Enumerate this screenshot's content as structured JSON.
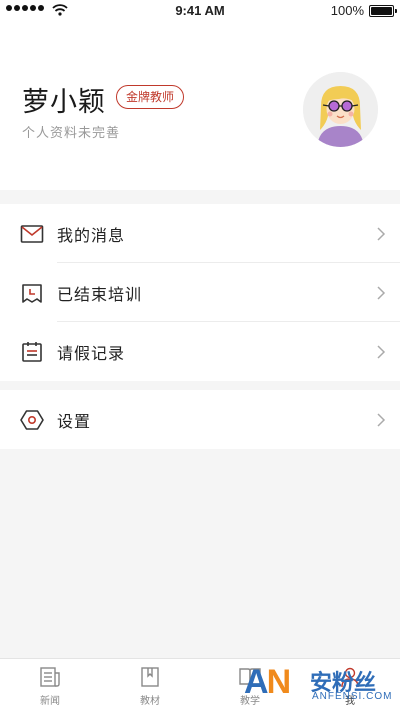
{
  "status_bar": {
    "time": "9:41 AM",
    "battery": "100%"
  },
  "profile": {
    "name": "萝小颖",
    "badge": "金牌教师",
    "subtitle": "个人资料未完善",
    "avatar_icon": "user-avatar-glasses"
  },
  "menu": {
    "messages": {
      "label": "我的消息",
      "icon": "mail-icon"
    },
    "finished_training": {
      "label": "已结束培训",
      "icon": "calendar-clock-icon"
    },
    "leave_records": {
      "label": "请假记录",
      "icon": "calendar-list-icon"
    },
    "settings": {
      "label": "设置",
      "icon": "hexagon-settings-icon"
    }
  },
  "tabs": [
    {
      "label": "新闻",
      "icon": "news-icon",
      "active": false
    },
    {
      "label": "教材",
      "icon": "book-icon",
      "active": false
    },
    {
      "label": "教学",
      "icon": "open-book-icon",
      "active": false
    },
    {
      "label": "我",
      "icon": "user-icon",
      "active": true
    }
  ],
  "watermark": {
    "logo_text": "AN",
    "cn": "安粉丝",
    "en": "ANFENSI.COM"
  },
  "colors": {
    "accent": "#c0392b",
    "icon_dark": "#333333",
    "divider": "#ececec",
    "background": "#f5f5f5"
  }
}
